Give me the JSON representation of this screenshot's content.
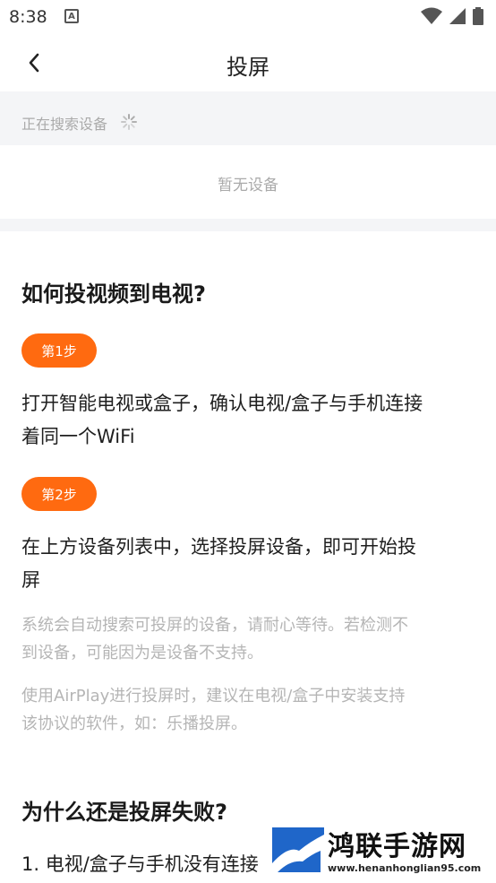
{
  "status_bar": {
    "time": "8:38",
    "notif_letter": "A"
  },
  "nav": {
    "title": "投屏"
  },
  "search": {
    "status_text": "正在搜索设备"
  },
  "devices": {
    "empty_text": "暂无设备"
  },
  "guide": {
    "heading": "如何投视频到电视?",
    "steps": [
      {
        "badge": "第1步",
        "line1": "打开智能电视或盒子，确认电视/盒子与手机连接",
        "line2": "着同一个WiFi"
      },
      {
        "badge": "第2步",
        "line1": "在上方设备列表中，选择投屏设备，即可开始投",
        "line2": "屏"
      }
    ],
    "notes": [
      {
        "line1": "系统会自动搜索可投屏的设备，请耐心等待。若检测不",
        "line2": "到设备，可能因为是设备不支持。"
      },
      {
        "line1": "使用AirPlay进行投屏时，建议在电视/盒子中安装支持",
        "line2": "该协议的软件，如：乐播投屏。"
      }
    ]
  },
  "failure": {
    "heading": "为什么还是投屏失败?",
    "item1": "1. 电视/盒子与手机没有连接"
  },
  "watermark": {
    "title": "鸿联手游网",
    "url": "www.henanhonglian95.com"
  },
  "colors": {
    "accent": "#ff6a10",
    "muted": "#aaaaaa",
    "section_bg": "#f4f5f7"
  }
}
